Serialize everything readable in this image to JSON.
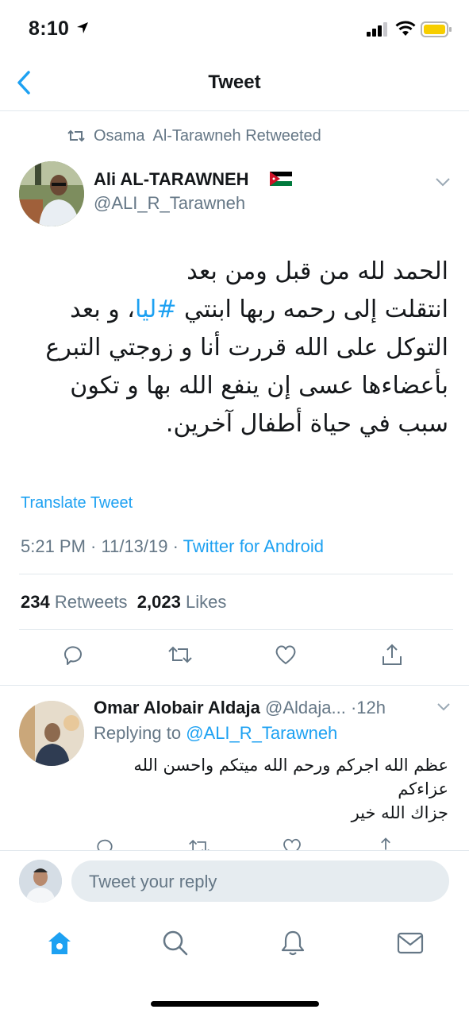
{
  "status": {
    "time": "8:10"
  },
  "nav": {
    "title": "Tweet",
    "back_icon": "chevron-left-icon"
  },
  "retweet": {
    "text": "Osama  Al-Tarawneh Retweeted"
  },
  "tweet": {
    "author_name": "Ali AL-TARAWNEH",
    "handle": "@ALI_R_Tarawneh",
    "body_before": "الحمد لله من قبل ومن بعد\nانتقلت إلى رحمه ربها ابنتي ",
    "hashtag": "#ليا",
    "body_after": "، و بعد التوكل على الله قررت أنا و زوجتي التبرع بأعضاءها عسى إن ينفع الله بها و تكون سبب في حياة أطفال آخرين.",
    "translate": "Translate Tweet",
    "time": "5:21 PM",
    "date": "11/13/19",
    "source": "Twitter for Android",
    "retweets_count": "234",
    "retweets_label": "Retweets",
    "likes_count": "2,023",
    "likes_label": "Likes"
  },
  "reply": {
    "name": "Omar Alobair Aldaja",
    "handle": "@Aldaja...",
    "age": "·12h",
    "replying_label": "Replying to ",
    "replying_handle": "@ALI_R_Tarawneh",
    "text": "عظم الله اجركم ورحم الله ميتكم واحسن الله عزاءكم\nجزاك الله خير"
  },
  "composer": {
    "placeholder": "Tweet your reply"
  },
  "colors": {
    "accent": "#1da1f2",
    "muted": "#657786",
    "text": "#14171a"
  }
}
